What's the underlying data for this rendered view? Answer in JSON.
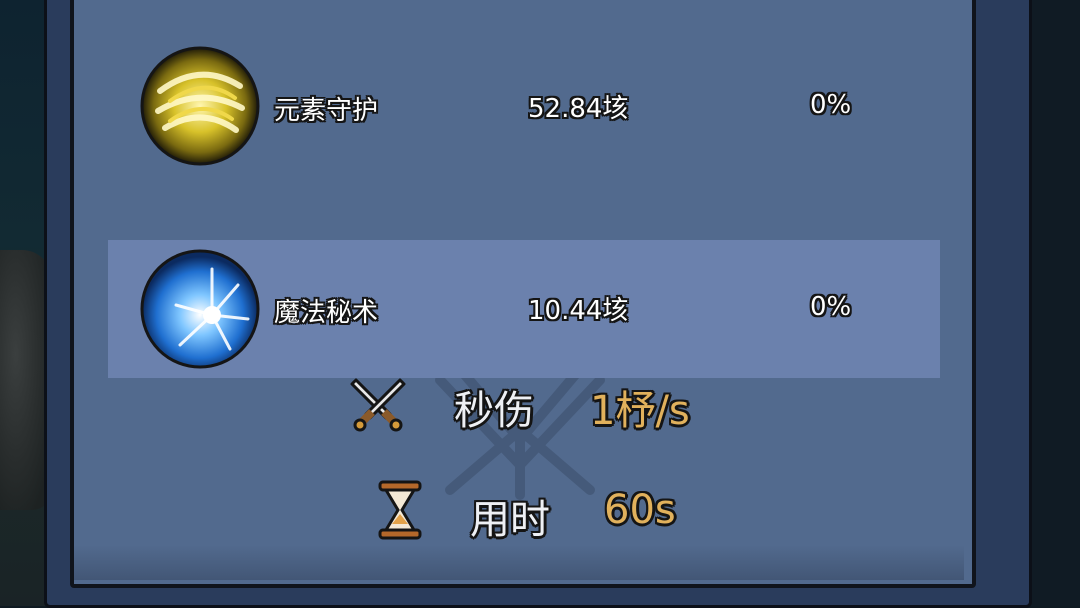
{
  "skills": [
    {
      "name": "元素守护",
      "damage": "52.84垓",
      "percent": "0%",
      "icon": "golden-vortex-icon"
    },
    {
      "name": "魔法秘术",
      "damage": "10.44垓",
      "percent": "0%",
      "icon": "blue-magic-orb-icon"
    }
  ],
  "dps": {
    "label": "秒伤",
    "value": "1杼/s",
    "icon": "crossed-swords-icon"
  },
  "time": {
    "label": "用时",
    "value": "60s",
    "icon": "hourglass-icon"
  },
  "colors": {
    "panel": "#526a8e",
    "highlight_row": "#6b81ad",
    "value_gold": "#e1b15c",
    "frame_dark": "#10141c"
  }
}
